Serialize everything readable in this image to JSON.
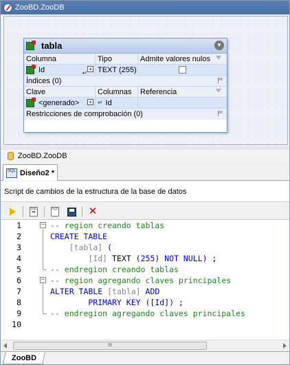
{
  "window": {
    "title": "ZooBD.ZooDB"
  },
  "table_box": {
    "name": "tabla",
    "col_headers": [
      "Columna",
      "Tipo",
      "Admite valores nulos"
    ],
    "column_row": {
      "name": "Id",
      "type": "TEXT (255)"
    },
    "indices_label": "Índices (0)",
    "key_headers": [
      "Clave",
      "Columnas",
      "Referencia"
    ],
    "key_row": {
      "name": "<generado>",
      "columns": "Id"
    },
    "constraints_label": "Restricciones de comprobación (0)"
  },
  "doc": {
    "title": "ZooBD.ZooDB"
  },
  "tab": {
    "label": "Diseño2 *"
  },
  "script": {
    "description": "Script de cambios de la estructura de la base de datos"
  },
  "editor": {
    "line_numbers": [
      "1",
      "2",
      "3",
      "4",
      "5",
      "6",
      "7",
      "8",
      "9",
      "10"
    ],
    "lines": {
      "l1": "-- region creando tablas",
      "l2": "CREATE TABLE",
      "l3a": "[tabla]",
      "l3b": "(",
      "l4a": "[Id]",
      "l4b": "TEXT",
      "l4c": "(255)",
      "l4d": "NOT NULL)",
      "l4e": ";",
      "l5": "-- endregion creando tablas",
      "l6": "-- region agregando claves principales",
      "l7a": "ALTER TABLE",
      "l7b": "[tabla]",
      "l7c": "ADD",
      "l8a": "PRIMARY KEY",
      "l8b": "([Id])",
      "l8c": ";",
      "l9": "-- endregion agregando claves principales"
    }
  },
  "scrollbar": {
    "grip": "III"
  },
  "bottom_tab": {
    "label": "ZooBD"
  },
  "colors": {
    "comment": "#208020",
    "keyword": "#0000e0",
    "identifier": "#888888",
    "titlebar": "#4a6fa5"
  }
}
